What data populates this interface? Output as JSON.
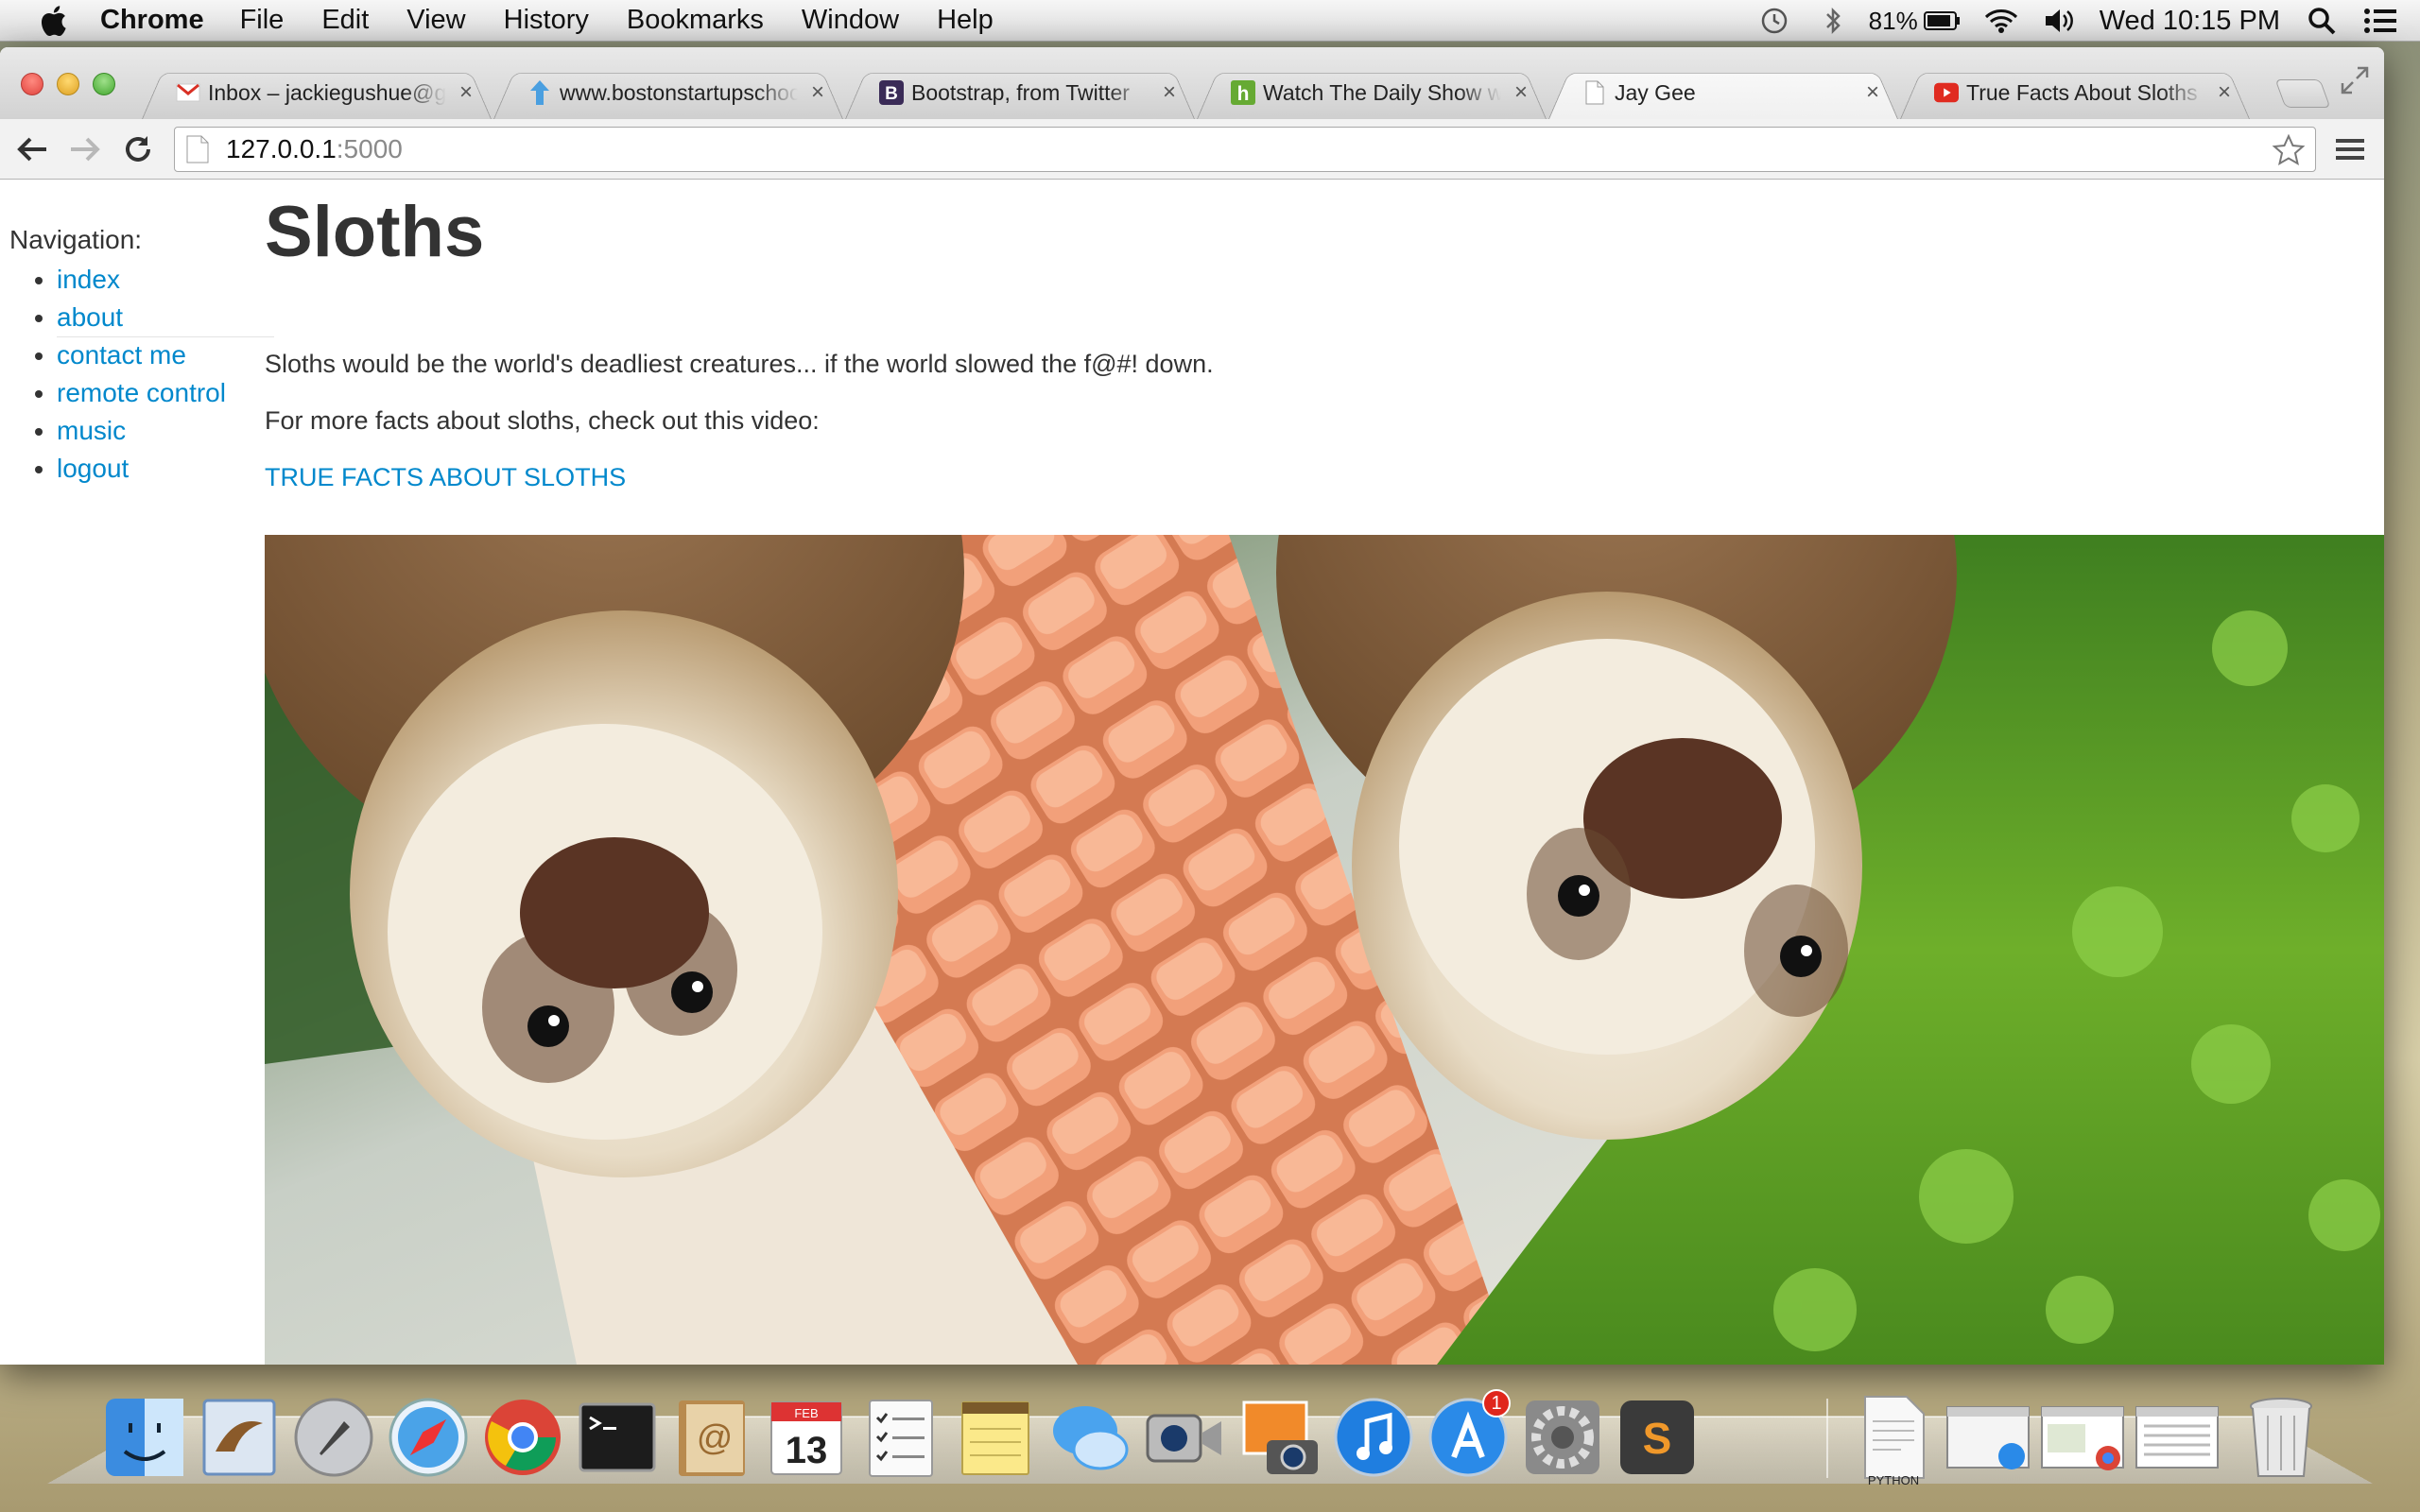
{
  "menubar": {
    "app_name": "Chrome",
    "items": [
      "File",
      "Edit",
      "View",
      "History",
      "Bookmarks",
      "Window",
      "Help"
    ],
    "battery_percent": "81%",
    "clock": "Wed 10:15 PM"
  },
  "tabs": [
    {
      "title": "Inbox – jackiegushue@gmail.com",
      "favicon": "gmail-icon",
      "active": false
    },
    {
      "title": "www.bostonstartupschool.com",
      "favicon": "upload-arrow-icon",
      "active": false
    },
    {
      "title": "Bootstrap, from Twitter",
      "favicon": "bootstrap-icon",
      "active": false
    },
    {
      "title": "Watch The Daily Show with Jon Stewart",
      "favicon": "hulu-icon",
      "active": false
    },
    {
      "title": "Jay Gee",
      "favicon": "blank-page-icon",
      "active": true
    },
    {
      "title": "True Facts About Sloths – YouTube",
      "favicon": "youtube-icon",
      "active": false
    }
  ],
  "omnibox": {
    "host": "127.0.0.1",
    "port": ":5000"
  },
  "sidebar": {
    "label": "Navigation:",
    "items": [
      {
        "label": "index"
      },
      {
        "label": "about"
      },
      {
        "label": "contact me"
      },
      {
        "label": "remote control"
      },
      {
        "label": "music"
      },
      {
        "label": "logout"
      }
    ]
  },
  "main": {
    "title": "Sloths",
    "paragraph1": "Sloths would be the world's deadliest creatures... if the world slowed the f@#! down.",
    "paragraph2": "For more facts about sloths, check out this video:",
    "video_link": "TRUE FACTS ABOUT SLOTHS"
  },
  "dock": {
    "apps": [
      "finder-icon",
      "mail-icon",
      "launchpad-icon",
      "safari-icon",
      "chrome-icon",
      "terminal-icon",
      "address-book-icon",
      "calendar-icon",
      "reminders-icon",
      "notes-icon",
      "messages-icon",
      "facetime-icon",
      "iphoto-icon",
      "itunes-icon",
      "app-store-icon",
      "system-preferences-icon",
      "sublime-text-icon"
    ],
    "calendar_month": "FEB",
    "calendar_day": "13",
    "app_store_badge": "1",
    "document_label": "PYTHON"
  },
  "colors": {
    "link": "#0088cc",
    "text": "#333333",
    "menubar": "#e8e8e8"
  }
}
